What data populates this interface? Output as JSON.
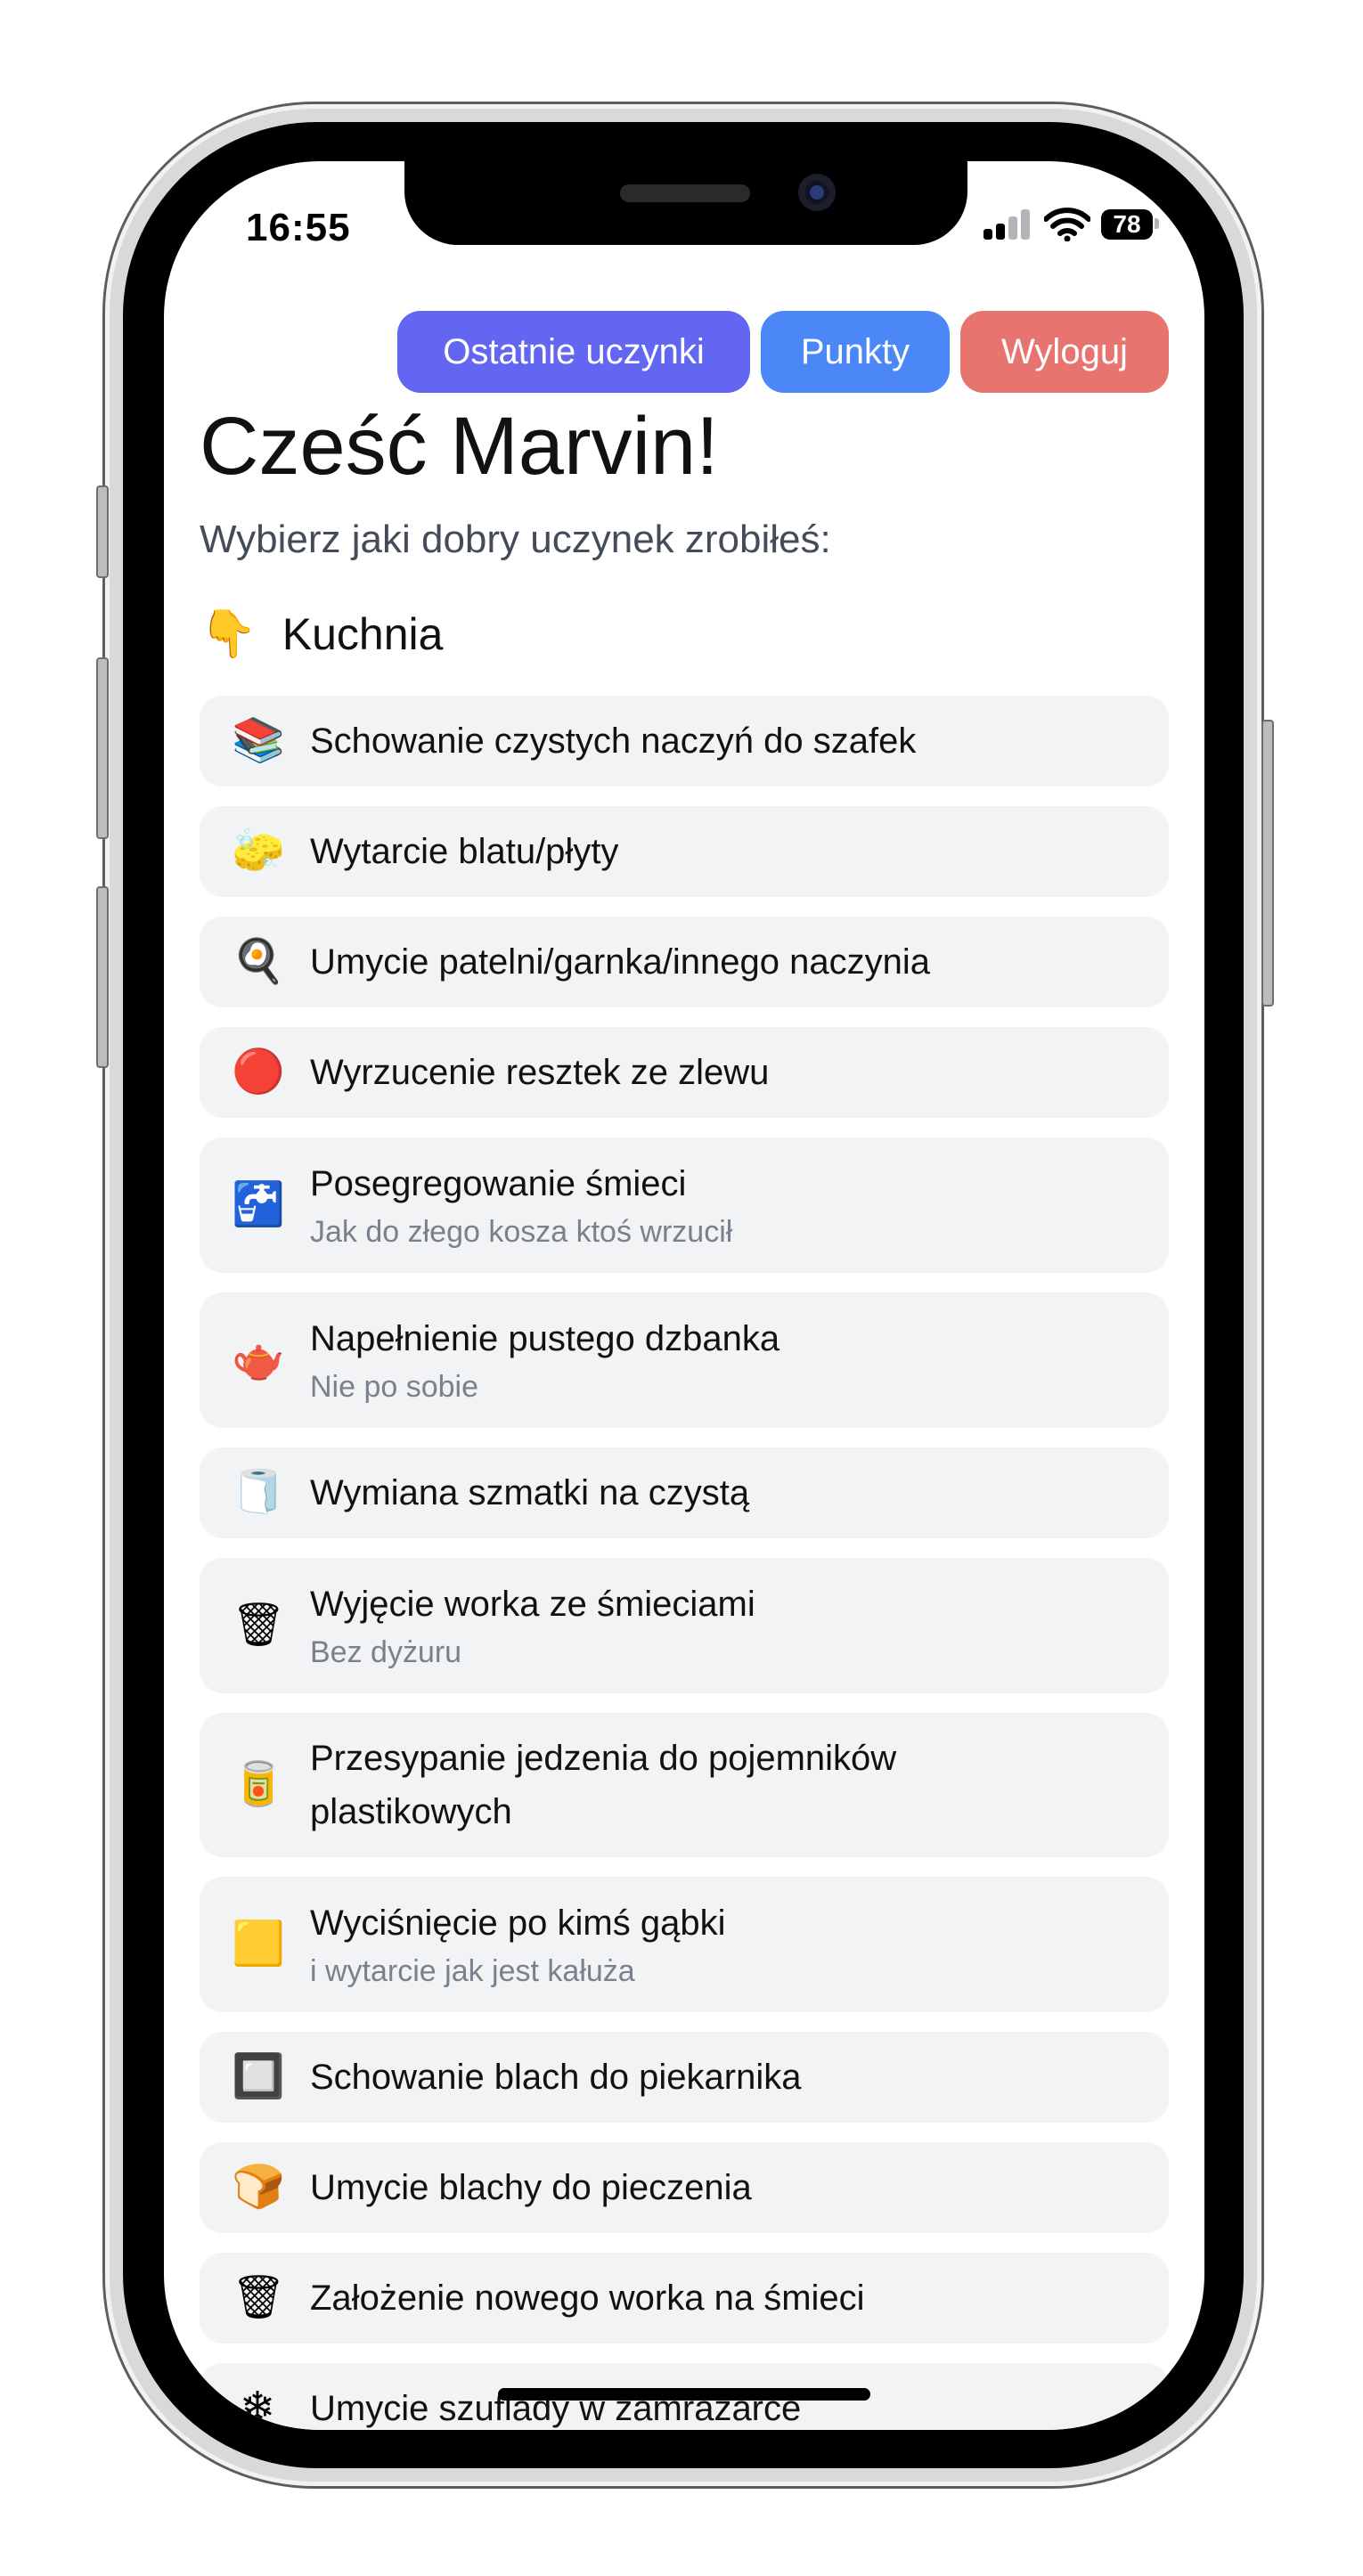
{
  "status": {
    "time": "16:55",
    "battery": "78"
  },
  "header": {
    "buttons": [
      {
        "label": "Ostatnie uczynki",
        "color": "#6366f1"
      },
      {
        "label": "Punkty",
        "color": "#4b87f7"
      },
      {
        "label": "Wyloguj",
        "color": "#e8746f"
      }
    ]
  },
  "greeting": "Cześć Marvin!",
  "subtitle": "Wybierz jaki dobry uczynek zrobiłeś:",
  "section": {
    "emoji": "👇",
    "title": "Kuchnia"
  },
  "items": [
    {
      "icon": "📚",
      "icon_name": "dishes-stack-icon",
      "label": "Schowanie czystych naczyń do szafek",
      "sub": ""
    },
    {
      "icon": "🧽",
      "icon_name": "wiping-hand-icon",
      "label": "Wytarcie blatu/płyty",
      "sub": ""
    },
    {
      "icon": "🍳",
      "icon_name": "frying-pan-icon",
      "label": "Umycie patelni/garnka/innego naczynia",
      "sub": ""
    },
    {
      "icon": "🔴",
      "icon_name": "sink-drain-icon",
      "label": "Wyrzucenie resztek ze zlewu",
      "sub": ""
    },
    {
      "icon": "🚰",
      "icon_name": "recycle-tap-icon",
      "label": "Posegregowanie śmieci",
      "sub": "Jak do złego kosza ktoś wrzucił"
    },
    {
      "icon": "🫖",
      "icon_name": "water-jug-icon",
      "label": "Napełnienie pustego dzbanka",
      "sub": "Nie po sobie"
    },
    {
      "icon": "🧻",
      "icon_name": "towel-icon",
      "label": "Wymiana szmatki na czystą",
      "sub": ""
    },
    {
      "icon": "🗑",
      "icon_name": "trash-bag-out-icon",
      "label": "Wyjęcie worka ze śmieciami",
      "sub": "Bez dyżuru"
    },
    {
      "icon": "🥫",
      "icon_name": "food-container-icon",
      "label": "Przesypanie jedzenia do pojemników plastikowych",
      "sub": ""
    },
    {
      "icon": "🟨",
      "icon_name": "sponge-icon",
      "label": "Wyciśnięcie po kimś gąbki",
      "sub": "i wytarcie jak jest kałuża"
    },
    {
      "icon": "🔲",
      "icon_name": "oven-icon",
      "label": "Schowanie blach do piekarnika",
      "sub": ""
    },
    {
      "icon": "🍞",
      "icon_name": "baking-tray-icon",
      "label": "Umycie blachy do pieczenia",
      "sub": ""
    },
    {
      "icon": "🗑",
      "icon_name": "trash-can-icon",
      "label": "Założenie nowego worka na śmieci",
      "sub": ""
    },
    {
      "icon": "❄",
      "icon_name": "freezer-icon",
      "label": "Umycie szuflady w zamrażarce",
      "sub": ""
    }
  ]
}
